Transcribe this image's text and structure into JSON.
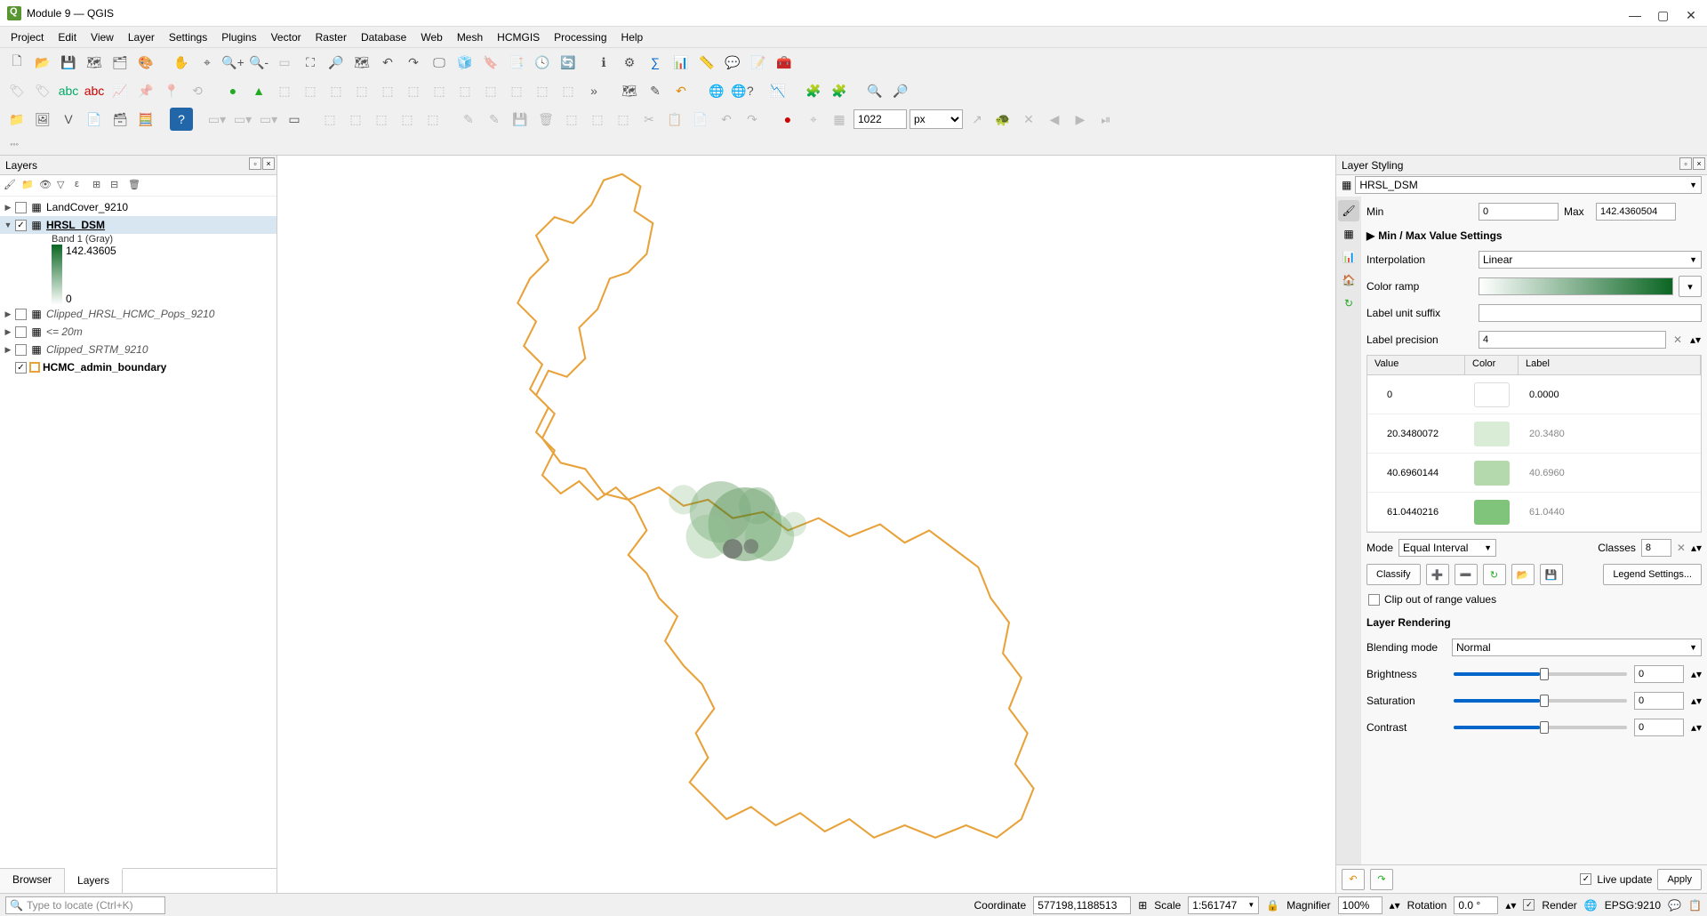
{
  "window": {
    "title": "Module 9 — QGIS"
  },
  "menu": [
    "Project",
    "Edit",
    "View",
    "Layer",
    "Settings",
    "Plugins",
    "Vector",
    "Raster",
    "Database",
    "Web",
    "Mesh",
    "HCMGIS",
    "Processing",
    "Help"
  ],
  "toolbox": {
    "coord_value": "1022",
    "coord_unit": "px"
  },
  "layers_panel": {
    "title": "Layers",
    "items": [
      {
        "name": "LandCover_9210",
        "checked": false,
        "expandable": true,
        "bold": false,
        "icon": "raster"
      },
      {
        "name": "HRSL_DSM",
        "checked": true,
        "expandable": true,
        "bold": true,
        "icon": "raster",
        "selected": true,
        "sub": {
          "band": "Band 1 (Gray)",
          "max": "142.43605",
          "min": "0"
        }
      },
      {
        "name": "Clipped_HRSL_HCMC_Pops_9210",
        "checked": false,
        "expandable": true,
        "italic": true,
        "icon": "raster"
      },
      {
        "name": "<= 20m",
        "checked": false,
        "expandable": true,
        "italic": true,
        "icon": "raster"
      },
      {
        "name": "Clipped_SRTM_9210",
        "checked": false,
        "expandable": true,
        "italic": true,
        "icon": "raster"
      },
      {
        "name": "HCMC_admin_boundary",
        "checked": true,
        "expandable": false,
        "bold": true,
        "icon": "polygon"
      }
    ],
    "tabs": [
      "Browser",
      "Layers"
    ],
    "active_tab": "Layers"
  },
  "styling": {
    "title": "Layer Styling",
    "layer": "HRSL_DSM",
    "min_label": "Min",
    "min": "0",
    "max_label": "Max",
    "max": "142.4360504",
    "minmax_section": "Min / Max Value Settings",
    "interpolation_label": "Interpolation",
    "interpolation": "Linear",
    "color_ramp_label": "Color ramp",
    "suffix_label": "Label unit suffix",
    "suffix": "",
    "precision_label": "Label precision",
    "precision": "4",
    "table_head": [
      "Value",
      "Color",
      "Label"
    ],
    "rows": [
      {
        "value": "0",
        "color": "#ffffff",
        "label": "0.0000",
        "dark": true
      },
      {
        "value": "20.3480072",
        "color": "#d9ecd6",
        "label": "20.3480"
      },
      {
        "value": "40.6960144",
        "color": "#b3d9ad",
        "label": "40.6960"
      },
      {
        "value": "61.0440216",
        "color": "#7fc47a",
        "label": "61.0440"
      }
    ],
    "mode_label": "Mode",
    "mode": "Equal Interval",
    "classes_label": "Classes",
    "classes": "8",
    "classify": "Classify",
    "legend_settings": "Legend Settings...",
    "clip": "Clip out of range values",
    "rendering_title": "Layer Rendering",
    "blend_label": "Blending mode",
    "blend": "Normal",
    "brightness_label": "Brightness",
    "brightness": "0",
    "saturation_label": "Saturation",
    "saturation": "0",
    "contrast_label": "Contrast",
    "contrast": "0",
    "live_update": "Live update",
    "apply": "Apply"
  },
  "status": {
    "locator_placeholder": "Type to locate (Ctrl+K)",
    "coord_label": "Coordinate",
    "coord": "577198,1188513",
    "scale_label": "Scale",
    "scale": "1:561747",
    "mag_label": "Magnifier",
    "mag": "100%",
    "rot_label": "Rotation",
    "rot": "0.0 °",
    "render": "Render",
    "crs": "EPSG:9210"
  }
}
